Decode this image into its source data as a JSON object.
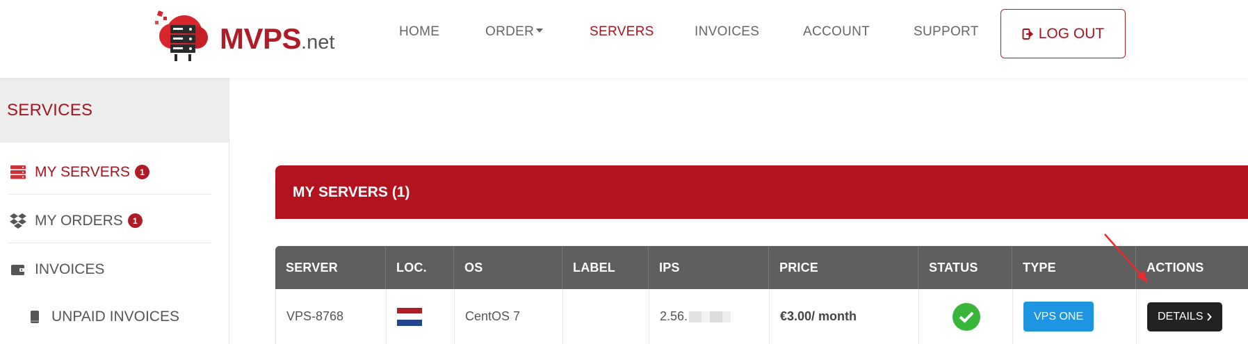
{
  "brand": {
    "name": "MVPS",
    "tld": ".net"
  },
  "nav": {
    "home": "HOME",
    "order": "ORDER",
    "servers": "SERVERS",
    "invoices": "INVOICES",
    "account": "ACCOUNT",
    "support": "SUPPORT",
    "logout": "LOG OUT"
  },
  "sidebar": {
    "heading": "SERVICES",
    "items": [
      {
        "label": "MY SERVERS",
        "badge": "1",
        "icon": "server-icon"
      },
      {
        "label": "MY ORDERS",
        "badge": "1",
        "icon": "dropbox-icon"
      },
      {
        "label": "INVOICES",
        "icon": "wallet-icon"
      },
      {
        "label": "UNPAID INVOICES",
        "icon": "book-icon"
      }
    ]
  },
  "main": {
    "panel_title": "MY SERVERS (1)",
    "columns": [
      "SERVER",
      "LOC.",
      "OS",
      "LABEL",
      "IPS",
      "PRICE",
      "STATUS",
      "TYPE",
      "ACTIONS"
    ],
    "rows": [
      {
        "server": "VPS-8768",
        "location_flag": "netherlands-flag",
        "os": "CentOS 7",
        "label": "",
        "ips": "2.56.",
        "price": "€3.00/ month",
        "status": "active",
        "type": "VPS ONE",
        "action": "DETAILS"
      }
    ]
  },
  "colors": {
    "brand_red": "#b3131e",
    "header_gray": "#5e5e5e",
    "type_blue": "#1d95e0",
    "status_green": "#39b539",
    "details_dark": "#222222"
  }
}
